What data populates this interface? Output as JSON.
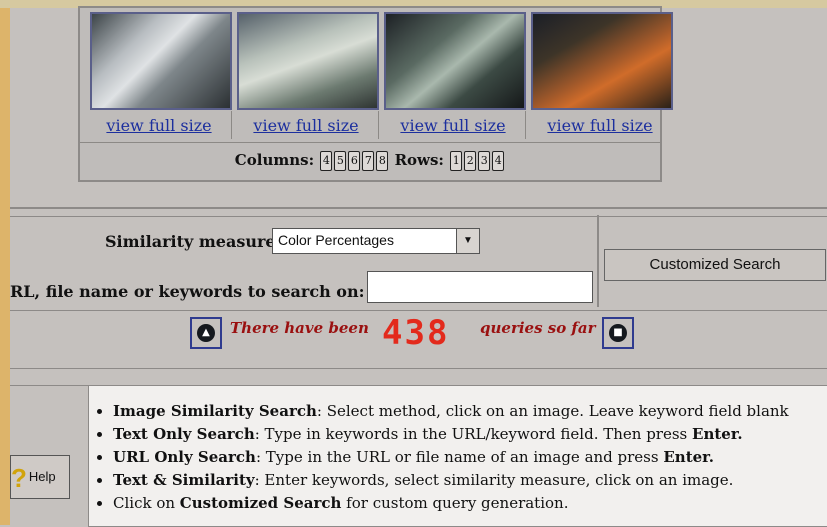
{
  "thumbnails": [
    {
      "link_label": "view full size"
    },
    {
      "link_label": "view full size"
    },
    {
      "link_label": "view full size"
    },
    {
      "link_label": "view full size"
    }
  ],
  "layout_controls": {
    "columns_label": "Columns:",
    "columns": [
      "4",
      "5",
      "6",
      "7",
      "8"
    ],
    "rows_label": "Rows:",
    "rows": [
      "1",
      "2",
      "3",
      "4"
    ]
  },
  "search": {
    "similarity_label": "Similarity measure:",
    "similarity_value": "Color Percentages",
    "keyword_label": "RL, file name or keywords to search on:",
    "keyword_value": "",
    "customized_button": "Customized Search"
  },
  "counter": {
    "prefix": "There have been",
    "count": "438",
    "suffix": "queries so far"
  },
  "help": {
    "button_label": "Help",
    "items": [
      {
        "title": "Image Similarity Search",
        "text": ": Select method, click on an image. Leave keyword field blank"
      },
      {
        "title": "Text Only Search",
        "text": ": Type in keywords in the URL/keyword field. Then press ",
        "emph": "Enter."
      },
      {
        "title": "URL Only Search",
        "text": ": Type in the URL or file name of an image and press ",
        "emph": "Enter."
      },
      {
        "title": "Text & Similarity",
        "text": ": Enter keywords, select similarity measure, click on an image."
      },
      {
        "pre": "Click on ",
        "title": "Customized Search",
        "text": " for custom query generation."
      }
    ]
  }
}
